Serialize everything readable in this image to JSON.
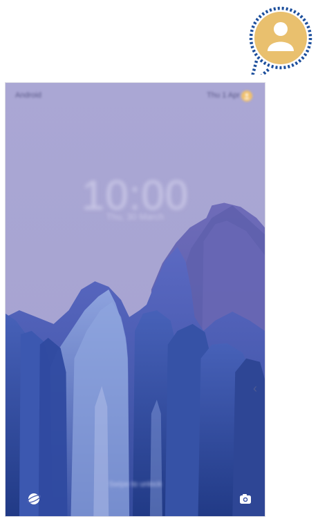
{
  "status_bar": {
    "carrier": "Android",
    "right_text": "Thu 1 Apr"
  },
  "lock_screen": {
    "clock": "10:00",
    "date": "Thu, 30 March",
    "bottom_hint": "Swipe to unlock"
  },
  "shortcuts": {
    "left_icon": "internet-icon",
    "right_icon": "camera-icon"
  },
  "colors": {
    "wallpaper_bg": "#a7a4d1",
    "callout_fill": "#e9c06e",
    "callout_ring": "#1d4f9c"
  }
}
